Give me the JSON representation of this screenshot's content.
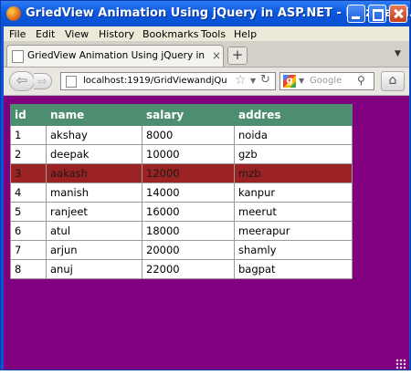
{
  "window": {
    "title": "GriedView Animation Using jQuery in ASP.NET - Mozilla Fi..."
  },
  "menu": [
    "File",
    "Edit",
    "View",
    "History",
    "Bookmarks",
    "Tools",
    "Help"
  ],
  "tab": {
    "label": "GriedView Animation Using jQuery in ASP.NET",
    "close": "×",
    "new_tab": "+"
  },
  "nav": {
    "url": "localhost:1919/GridViewandjQu",
    "search_placeholder": "Google"
  },
  "grid": {
    "columns": [
      "id",
      "name",
      "salary",
      "addres"
    ],
    "rows": [
      [
        "1",
        "akshay",
        "8000",
        "noida"
      ],
      [
        "2",
        "deepak",
        "10000",
        "gzb"
      ],
      [
        "3",
        "aakash",
        "12000",
        "mzb"
      ],
      [
        "4",
        "manish",
        "14000",
        "kanpur"
      ],
      [
        "5",
        "ranjeet",
        "16000",
        "meerut"
      ],
      [
        "6",
        "atul",
        "18000",
        "meerapur"
      ],
      [
        "7",
        "arjun",
        "20000",
        "shamly"
      ],
      [
        "8",
        "anuj",
        "22000",
        "bagpat"
      ]
    ],
    "selected_row_id": "3"
  },
  "colors": {
    "page_background": "#800080",
    "header_background": "#4d8d70",
    "selected_row_background": "#9a2222"
  }
}
